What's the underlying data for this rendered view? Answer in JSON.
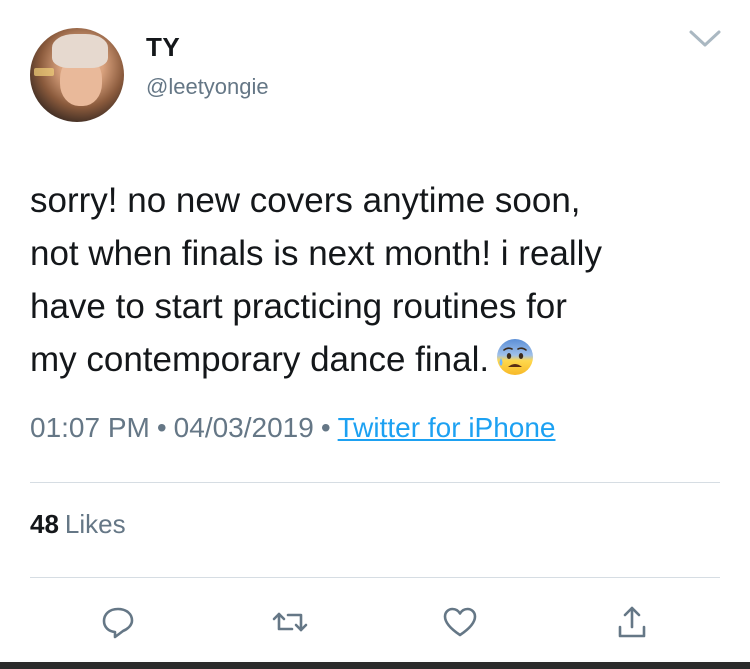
{
  "author": {
    "name": "TY",
    "handle": "@leetyongie"
  },
  "tweet": {
    "lines": [
      "sorry! no new covers anytime soon,",
      "not when finals is next month! i really",
      "have to start practicing routines for",
      "my contemporary dance final."
    ],
    "emoji": "anxious-face-with-sweat"
  },
  "meta": {
    "time": "01:07 PM",
    "separator": "•",
    "date": "04/03/2019",
    "source": "Twitter for iPhone"
  },
  "stats": {
    "likes_count": "48",
    "likes_label": "Likes"
  },
  "actions": [
    {
      "icon": "reply-icon"
    },
    {
      "icon": "retweet-icon"
    },
    {
      "icon": "like-icon"
    },
    {
      "icon": "share-icon"
    }
  ],
  "colors": {
    "text": "#14171a",
    "secondary": "#657786",
    "link": "#1da1f2",
    "divider": "#d6dde3"
  }
}
